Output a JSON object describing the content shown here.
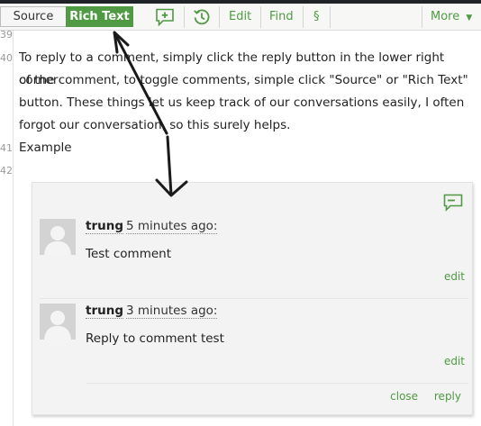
{
  "toolbar": {
    "source_label": "Source",
    "rich_text_label": "Rich Text",
    "edit_label": "Edit",
    "find_label": "Find",
    "section_label": "§",
    "more_label": "More"
  },
  "editor": {
    "line_numbers": [
      "39",
      "40",
      "41",
      "42"
    ],
    "paragraph_lines": [
      "To reply to a comment, simply click the reply button in the lower right corner",
      "of the comment, to toggle comments, simple click \"Source\" or \"Rich Text\"",
      "button. These things let us keep track of our conversations easily, I often",
      "forgot our conversation, so this surely helps."
    ],
    "example_line": "Example"
  },
  "comments": [
    {
      "author": "trung",
      "time": "5 minutes ago:",
      "text": "Test comment",
      "edit_label": "edit"
    },
    {
      "author": "trung",
      "time": "3 minutes ago:",
      "text": "Reply to comment test",
      "edit_label": "edit"
    }
  ],
  "comment_actions": {
    "close_label": "close",
    "reply_label": "reply"
  },
  "colors": {
    "accent": "#4f9a43",
    "panel_bg": "#f3f3f3",
    "toolbar_bg": "#f7f7f6"
  }
}
